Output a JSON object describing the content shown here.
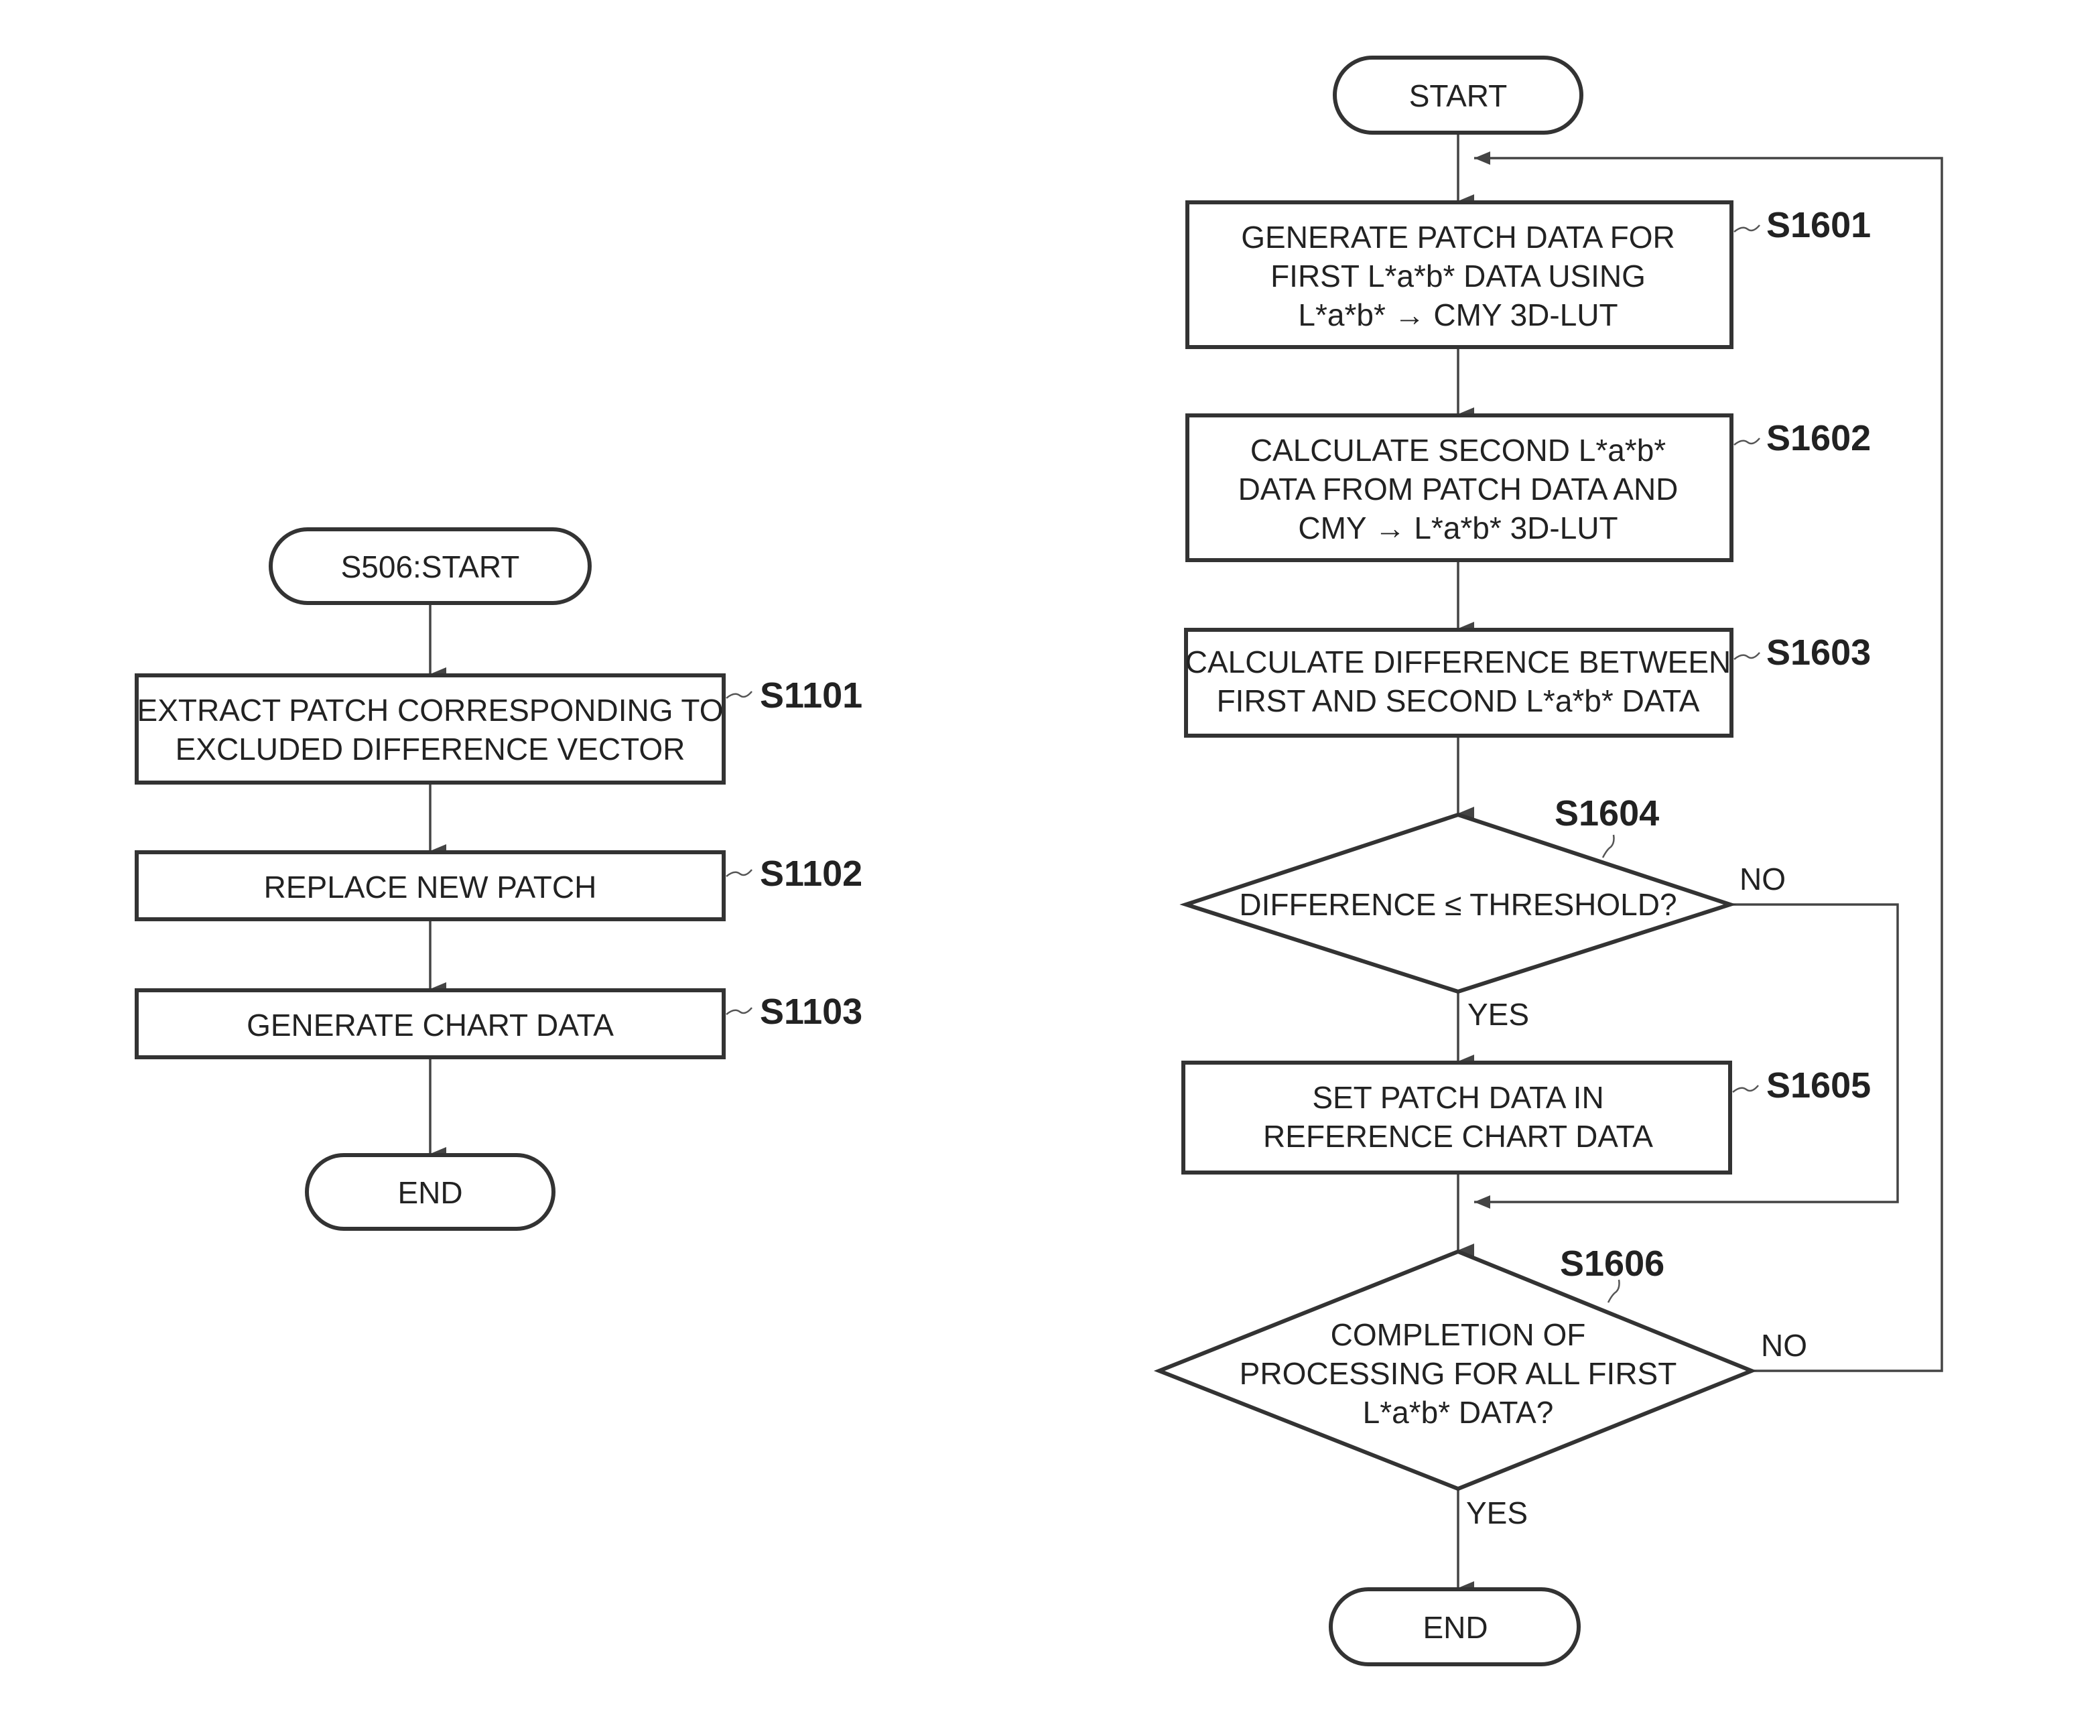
{
  "left_flow": {
    "start": "S506:START",
    "steps": [
      {
        "id": "S1101",
        "lines": [
          "EXTRACT PATCH CORRESPONDING TO",
          "EXCLUDED DIFFERENCE VECTOR"
        ]
      },
      {
        "id": "S1102",
        "lines": [
          "REPLACE NEW PATCH"
        ]
      },
      {
        "id": "S1103",
        "lines": [
          "GENERATE CHART DATA"
        ]
      }
    ],
    "end": "END"
  },
  "right_flow": {
    "start": "START",
    "steps": [
      {
        "id": "S1601",
        "lines": [
          "GENERATE PATCH DATA FOR",
          "FIRST L*a*b* DATA USING",
          "L*a*b* → CMY 3D-LUT"
        ]
      },
      {
        "id": "S1602",
        "lines": [
          "CALCULATE SECOND L*a*b*",
          "DATA FROM PATCH DATA AND",
          "CMY → L*a*b* 3D-LUT"
        ]
      },
      {
        "id": "S1603",
        "lines": [
          "CALCULATE DIFFERENCE BETWEEN",
          "FIRST AND SECOND L*a*b* DATA"
        ]
      },
      {
        "id": "S1605",
        "lines": [
          "SET PATCH DATA IN",
          "REFERENCE CHART DATA"
        ]
      }
    ],
    "decisions": [
      {
        "id": "S1604",
        "lines": [
          "DIFFERENCE ≤ THRESHOLD?"
        ],
        "yes": "YES",
        "no": "NO"
      },
      {
        "id": "S1606",
        "lines": [
          "COMPLETION OF",
          "PROCESSING FOR ALL FIRST",
          "L*a*b* DATA?"
        ],
        "yes": "YES",
        "no": "NO"
      }
    ],
    "end": "END"
  }
}
